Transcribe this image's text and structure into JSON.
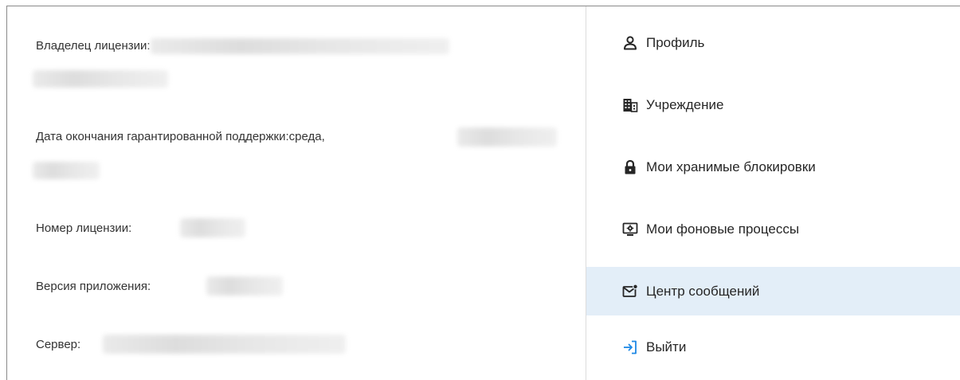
{
  "license": {
    "owner_label": "Владелец лицензии:",
    "support_end_label": "Дата окончания гарантированной поддержки:",
    "support_end_weekday": "среда,",
    "license_number_label": "Номер лицензии:",
    "app_version_label": "Версия приложения:",
    "server_label": "Сервер:"
  },
  "menu": {
    "items": [
      {
        "label": "Профиль",
        "icon": "user-icon"
      },
      {
        "label": "Учреждение",
        "icon": "building-icon"
      },
      {
        "label": "Мои хранимые блокировки",
        "icon": "lock-icon"
      },
      {
        "label": "Мои фоновые процессы",
        "icon": "monitor-gear-icon"
      },
      {
        "label": "Центр сообщений",
        "icon": "mail-notification-icon",
        "active": true
      },
      {
        "label": "Выйти",
        "icon": "logout-icon"
      }
    ]
  },
  "colors": {
    "active_item_bg": "#e3eef8",
    "logout_icon": "#1e88e5",
    "text": "#262626"
  }
}
